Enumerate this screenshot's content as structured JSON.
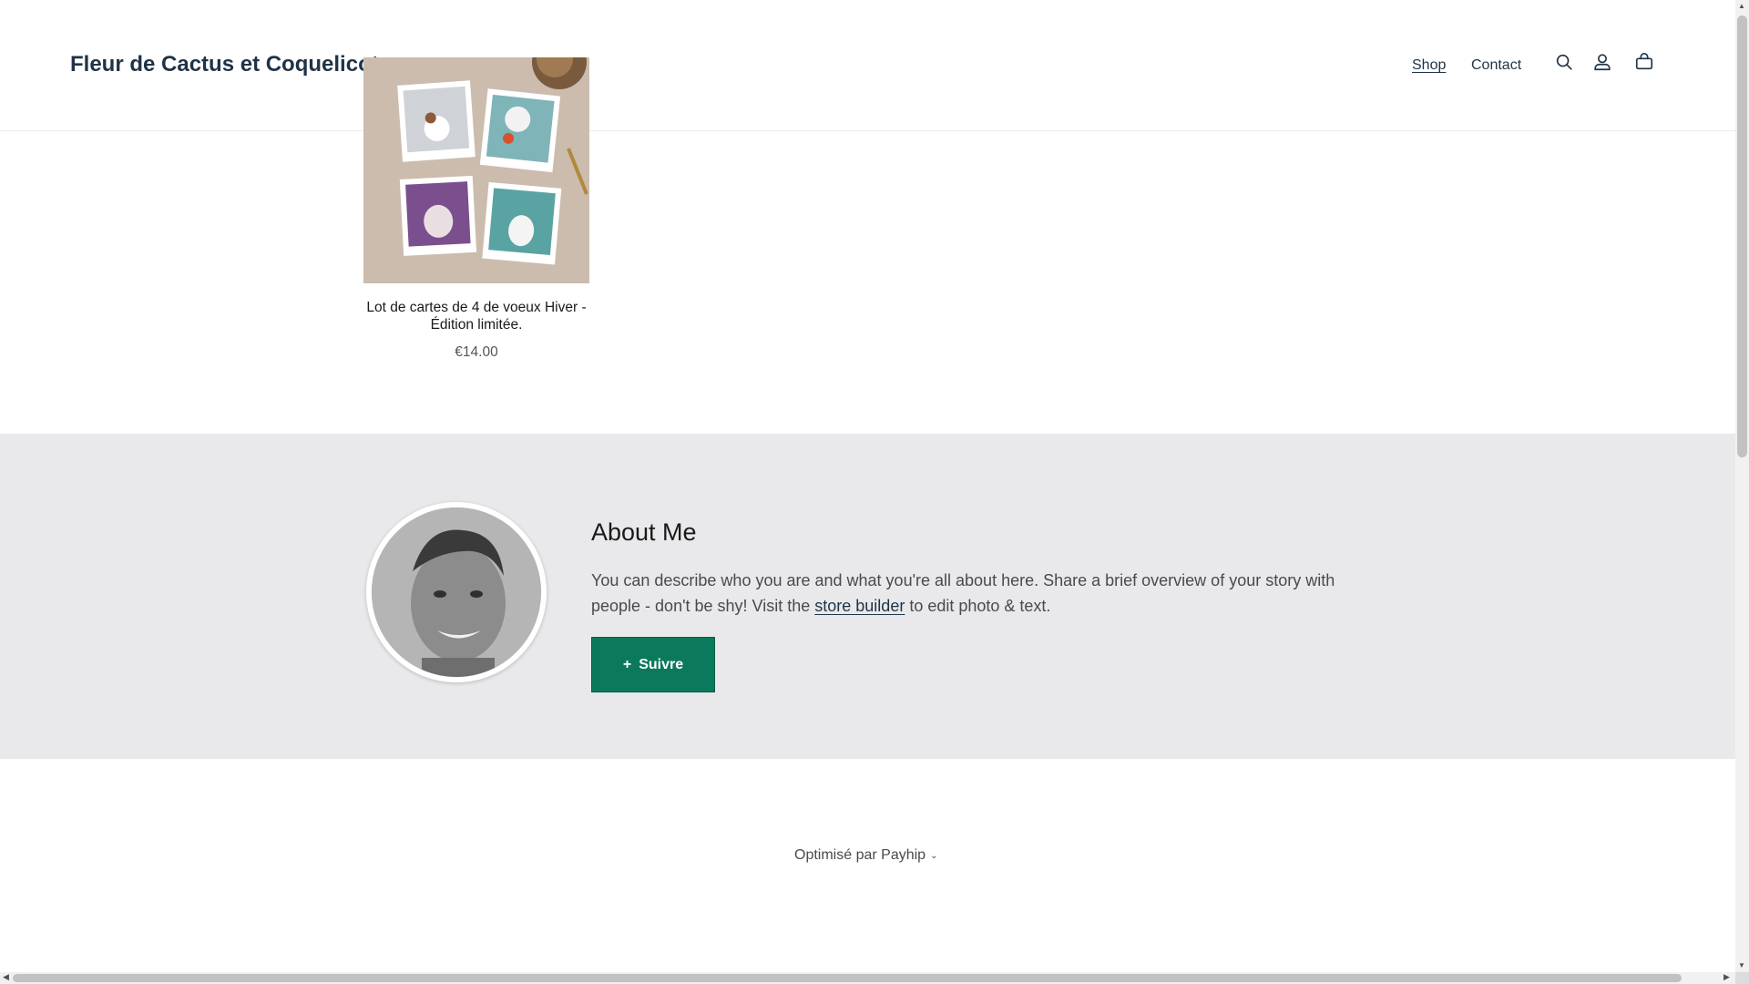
{
  "header": {
    "logo": "Fleur de Cactus et Coquelicots",
    "nav": {
      "shop": "Shop",
      "contact": "Contact"
    },
    "icons": [
      "search-icon",
      "account-icon",
      "cart-icon"
    ]
  },
  "product": {
    "title": "Lot de cartes de 4 de voeux Hiver - Édition limitée.",
    "price": "€14.00"
  },
  "about": {
    "title": "About Me",
    "text_before": "You can describe who you are and what you're all about here. Share a brief overview of your story with people - don't be shy! Visit the ",
    "link": "store builder",
    "text_after": " to edit photo & text.",
    "follow_icon": "+",
    "follow_label": "Suivre",
    "accent_color": "#0b7a5c"
  },
  "footer": {
    "powered_by": "Optimisé par Payhip",
    "chevron": "⌄"
  }
}
